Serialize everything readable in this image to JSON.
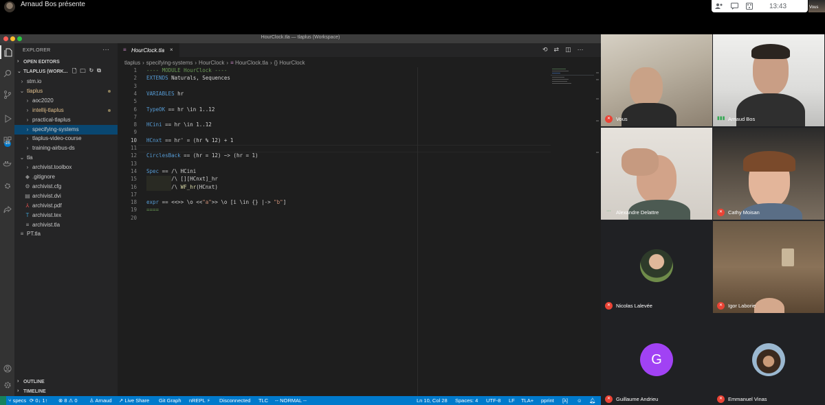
{
  "meeting": {
    "presenter_text": "Arnaud Bos présente",
    "clock": "13:43",
    "self_label": "Vous"
  },
  "window": {
    "title": "HourClock.tla — tlaplus (Workspace)"
  },
  "activity_bar": {
    "scm_badge": "16"
  },
  "explorer": {
    "title": "EXPLORER",
    "more": "···",
    "open_editors": "OPEN EDITORS",
    "workspace": "TLAPLUS (WORK...",
    "items": [
      {
        "label": "stm.io",
        "icon": "chevron-right",
        "depth": 1
      },
      {
        "label": "tlaplus",
        "icon": "chevron-down",
        "depth": 1,
        "modified": true
      },
      {
        "label": "aoc2020",
        "icon": "chevron-right",
        "depth": 2
      },
      {
        "label": "intellij-tlaplus",
        "icon": "chevron-right",
        "depth": 2,
        "modified": true
      },
      {
        "label": "practical-tlaplus",
        "icon": "chevron-right",
        "depth": 2
      },
      {
        "label": "specifying-systems",
        "icon": "chevron-right",
        "depth": 2,
        "selected": true
      },
      {
        "label": "tlaplus-video-course",
        "icon": "chevron-right",
        "depth": 2
      },
      {
        "label": "training-airbus-ds",
        "icon": "chevron-right",
        "depth": 2
      },
      {
        "label": "tla",
        "icon": "chevron-down",
        "depth": 1
      },
      {
        "label": "archivist.toolbox",
        "icon": "chevron-right",
        "depth": 2
      },
      {
        "label": ".gitignore",
        "icon": "gitignore",
        "depth": 2
      },
      {
        "label": "archivist.cfg",
        "icon": "gear",
        "depth": 2
      },
      {
        "label": "archivist.dvi",
        "icon": "file",
        "depth": 2
      },
      {
        "label": "archivist.pdf",
        "icon": "pdf",
        "depth": 2
      },
      {
        "label": "archivist.tex",
        "icon": "tex",
        "depth": 2
      },
      {
        "label": "archivist.tla",
        "icon": "lines",
        "depth": 2
      },
      {
        "label": "PT.tla",
        "icon": "lines",
        "depth": 1
      }
    ],
    "outline": "OUTLINE",
    "timeline": "TIMELINE"
  },
  "editor": {
    "tab_label": "HourClock.tla",
    "tab_close": "×",
    "breadcrumb": [
      "tlaplus",
      "specifying-systems",
      "HourClock",
      "HourClock.tla",
      "{} HourClock"
    ],
    "line_numbers": [
      "1",
      "2",
      "3",
      "4",
      "5",
      "6",
      "7",
      "8",
      "9",
      "10",
      "11",
      "12",
      "13",
      "14",
      "15",
      "16",
      "17",
      "18",
      "19",
      "20"
    ],
    "current_line": 10
  },
  "status_bar": {
    "branch": "specs",
    "sync": "0↓ 1↑",
    "problems": "⊗ 8 ⚠ 0",
    "author": "Arnaud",
    "live_share": "Live Share",
    "git_graph": "Git Graph",
    "nrepl": "nREPL",
    "disconnected": "Disconnected",
    "tlc": "TLC",
    "mode": "-- NORMAL --",
    "position": "Ln 10, Col 28",
    "spaces": "Spaces: 4",
    "encoding": "UTF-8",
    "eol": "LF",
    "language": "TLA+",
    "pprint": "pprint",
    "lambda": "[λ]"
  },
  "participants": [
    {
      "name": "Vous",
      "muted": true,
      "kind": "video"
    },
    {
      "name": "Arnaud Bos",
      "muted": false,
      "kind": "video"
    },
    {
      "name": "Alexandre Delattre",
      "muted": false,
      "kind": "video"
    },
    {
      "name": "Cathy Moisan",
      "muted": true,
      "kind": "video"
    },
    {
      "name": "Nicolas Lalevée",
      "muted": true,
      "kind": "photo"
    },
    {
      "name": "Igor Laborie",
      "muted": true,
      "kind": "video"
    },
    {
      "name": "Guillaume Andrieu",
      "muted": true,
      "kind": "letter",
      "letter": "G",
      "color": "#a142f4"
    },
    {
      "name": "Emmanuel Vinas",
      "muted": true,
      "kind": "photo"
    }
  ],
  "colors": {
    "status_bar": "#007acc",
    "selection": "#094771",
    "meet_mic_off": "#ea4335",
    "keyword": "#569cd6",
    "string": "#ce9178",
    "comment": "#6a9955"
  }
}
